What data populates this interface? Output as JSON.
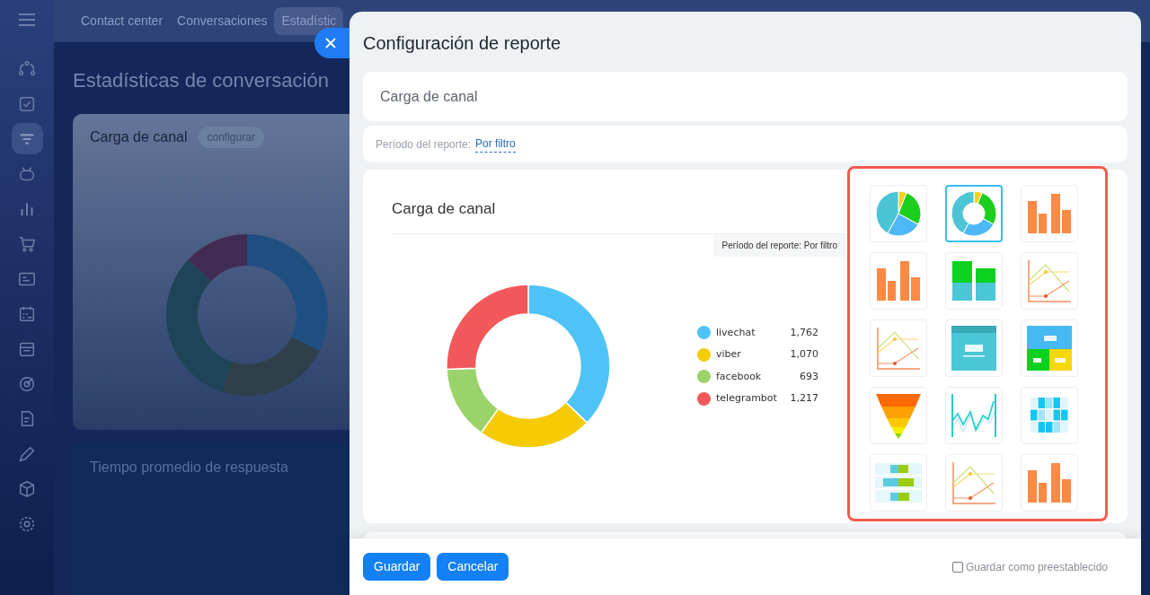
{
  "top_tabs": [
    {
      "label": "Contact center",
      "selected": false
    },
    {
      "label": "Conversaciones",
      "selected": false
    },
    {
      "label": "Estadístic",
      "selected": true
    }
  ],
  "page_title": "Estadísticas de conversación",
  "background_cards": [
    {
      "title": "Carga de canal",
      "action": "configurar"
    },
    {
      "title": "Tiempo promedio de respuesta"
    }
  ],
  "sidebar": {
    "items": [
      {
        "kind": "flow",
        "selected": false
      },
      {
        "kind": "task",
        "selected": false
      },
      {
        "kind": "filter",
        "selected": true
      },
      {
        "kind": "bot",
        "selected": false
      },
      {
        "kind": "chart",
        "selected": false
      },
      {
        "kind": "cart",
        "selected": false
      },
      {
        "kind": "card",
        "selected": false
      },
      {
        "kind": "calendar",
        "selected": false
      },
      {
        "kind": "store",
        "selected": false
      },
      {
        "kind": "target",
        "selected": false
      },
      {
        "kind": "doc",
        "selected": false
      },
      {
        "kind": "pen",
        "selected": false
      },
      {
        "kind": "box",
        "selected": false
      },
      {
        "kind": "gear",
        "selected": false
      }
    ]
  },
  "dialog": {
    "title": "Configuración de reporte",
    "name_field": {
      "value": "Carga de canal"
    },
    "period": {
      "label": "Período del reporte:",
      "value": "Por filtro"
    },
    "preview": {
      "title": "Carga de canal",
      "period_badge": "Período del reporte: Por filtro",
      "chart_data": {
        "type": "donut",
        "categories": [
          "livechat",
          "viber",
          "facebook",
          "telegrambot"
        ],
        "series": [
          {
            "values": [
              37.2,
              22.6,
              14.6,
              25.6
            ]
          }
        ],
        "colors": [
          "#4fc3f7",
          "#f5cb05",
          "#9ad36a",
          "#f2585a"
        ],
        "value_labels": [
          "1,762",
          "1,070",
          "693",
          "1,217"
        ]
      }
    },
    "chart_types": [
      {
        "kind": "pie",
        "selected": false
      },
      {
        "kind": "donut",
        "selected": true
      },
      {
        "kind": "bar",
        "selected": false
      },
      {
        "kind": "bar",
        "selected": false
      },
      {
        "kind": "stacked",
        "selected": false
      },
      {
        "kind": "line",
        "selected": false
      },
      {
        "kind": "line",
        "selected": false
      },
      {
        "kind": "number",
        "selected": false
      },
      {
        "kind": "tiles",
        "selected": false
      },
      {
        "kind": "funnel",
        "selected": false
      },
      {
        "kind": "wave",
        "selected": false
      },
      {
        "kind": "heatmap",
        "selected": false
      },
      {
        "kind": "hbar",
        "selected": false
      },
      {
        "kind": "line",
        "selected": false
      },
      {
        "kind": "bar",
        "selected": false
      }
    ],
    "buttons": [
      "Guardar",
      "Cancelar"
    ],
    "preset": {
      "label": "Guardar como preestablecido",
      "checked": false
    }
  }
}
